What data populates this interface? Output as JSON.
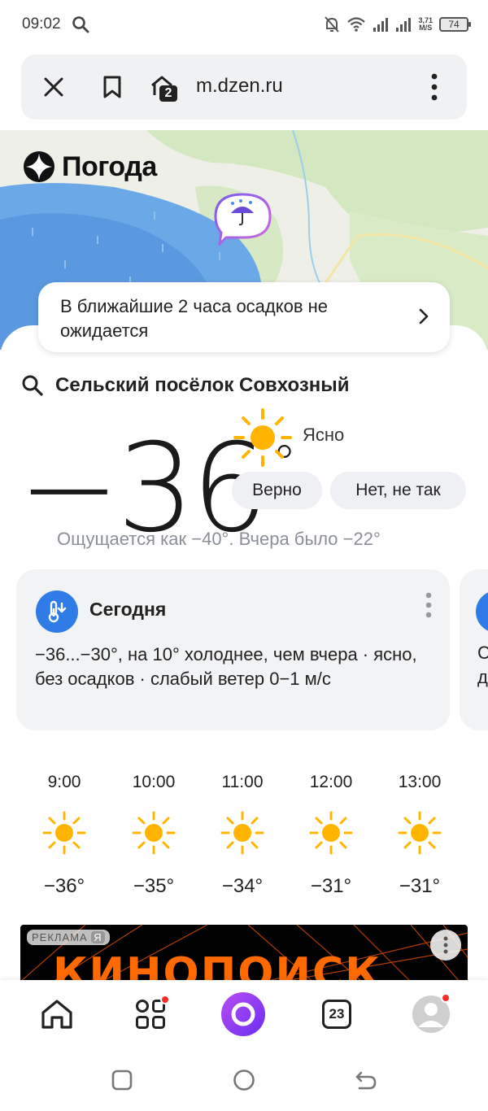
{
  "status_bar": {
    "time": "09:02",
    "speed_value": "3,71",
    "speed_unit": "M/S",
    "battery": "74"
  },
  "browser": {
    "url": "m.dzen.ru",
    "tab_count": "2"
  },
  "map": {
    "logo_text": "Погода",
    "precip_message": "В ближайшие 2 часа осадков не ожидается"
  },
  "weather": {
    "location": "Сельский посёлок Совхозный",
    "temperature": "−36",
    "degree": "°",
    "condition": "Ясно",
    "confirm_label": "Верно",
    "deny_label": "Нет, не так",
    "feels_like": "Ощущается как −40°. Вчера было −22°"
  },
  "today_card": {
    "title": "Сегодня",
    "text": "−36...−30°, на 10° холоднее, чем вчера · ясно, без осадков · слабый ветер 0−1 м/с",
    "next_card_text_1": "С",
    "next_card_text_2": "д"
  },
  "hourly": [
    {
      "time": "9:00",
      "temp": "−36°"
    },
    {
      "time": "10:00",
      "temp": "−35°"
    },
    {
      "time": "11:00",
      "temp": "−34°"
    },
    {
      "time": "12:00",
      "temp": "−31°"
    },
    {
      "time": "13:00",
      "temp": "−31°"
    }
  ],
  "ad": {
    "label": "РЕКЛАМА",
    "label_mark": "Я",
    "brand": "КИНОПОИСК"
  },
  "bottom_nav": {
    "calendar_day": "23"
  },
  "colors": {
    "accent_blue": "#2f7ce6",
    "alice_purple": "#7b3ff2",
    "sun_yellow": "#ffb300",
    "ad_orange": "#ff6a00"
  }
}
